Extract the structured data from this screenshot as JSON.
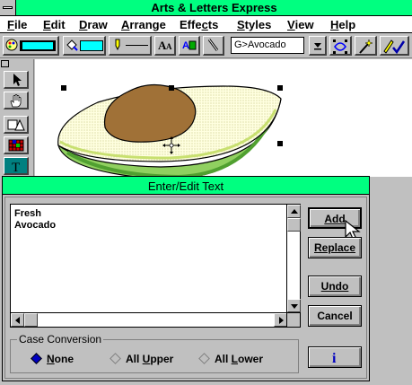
{
  "app": {
    "title": "Arts & Letters Express"
  },
  "menu": {
    "items": [
      {
        "accel": "F",
        "rest": "ile"
      },
      {
        "accel": "E",
        "rest": "dit"
      },
      {
        "accel": "D",
        "rest": "raw"
      },
      {
        "accel": "A",
        "rest": "rrange"
      },
      {
        "accel": "",
        "rest": "Effe",
        "accel2": "c",
        "rest2": "ts"
      },
      {
        "accel": "S",
        "rest": "tyles"
      },
      {
        "accel": "V",
        "rest": "iew"
      },
      {
        "accel": "H",
        "rest": "elp"
      }
    ]
  },
  "toolbar": {
    "style_name": "G>Avocado",
    "fill_color": "#00ffff",
    "line_color": "#00ffff"
  },
  "dialog": {
    "title": "Enter/Edit Text",
    "text_lines": "Fresh\nAvocado",
    "buttons": {
      "add": "Add",
      "replace": "Replace",
      "undo": "Undo",
      "cancel": "Cancel",
      "info_icon": "info-icon"
    },
    "case_conversion": {
      "legend": "Case Conversion",
      "options": [
        {
          "accel": "N",
          "rest": "one",
          "selected": true
        },
        {
          "accel": "",
          "rest": "All ",
          "accel2": "U",
          "rest2": "pper",
          "selected": false
        },
        {
          "accel": "",
          "rest": "All ",
          "accel2": "L",
          "rest2": "ower",
          "selected": false
        }
      ]
    }
  },
  "colors": {
    "title_bar": "#00ff80",
    "accent_blue": "#0000c0"
  }
}
